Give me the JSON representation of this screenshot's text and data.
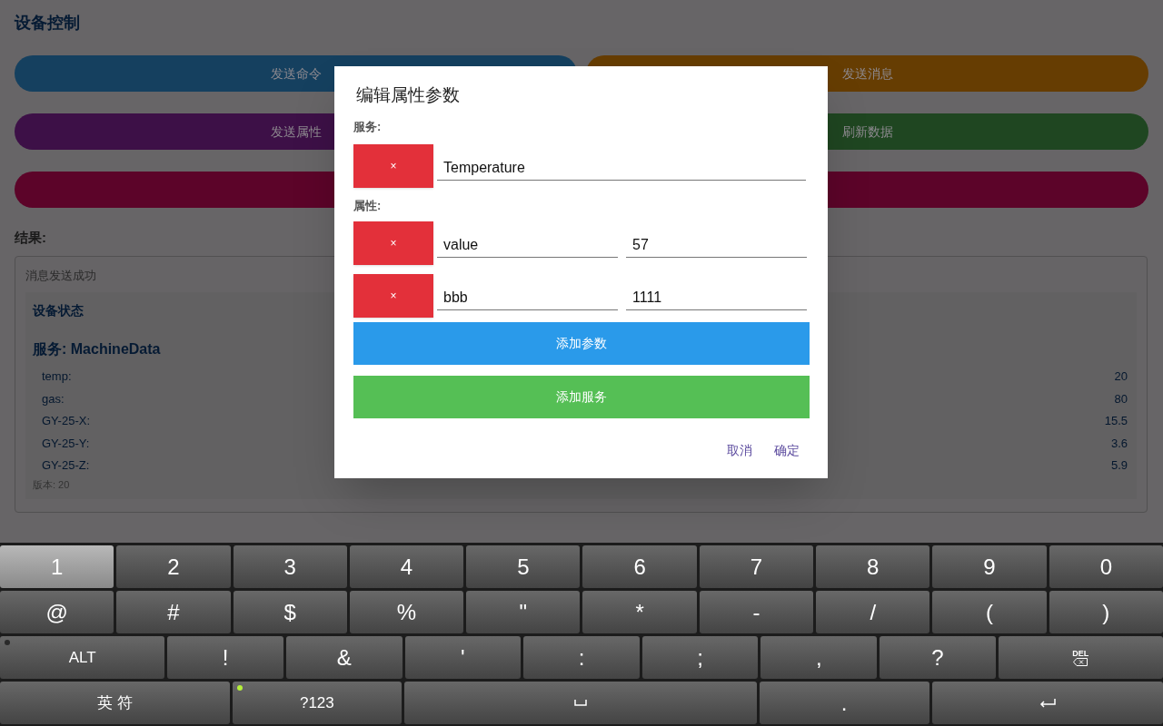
{
  "page": {
    "title": "设备控制",
    "buttons": [
      {
        "label": "发送命令",
        "color": "#15405f"
      },
      {
        "label": "发送消息",
        "color": "#663d02"
      },
      {
        "label": "发送属性",
        "color": "#3d1047"
      },
      {
        "label": "刷新数据",
        "color": "#1f4621"
      },
      {
        "color": "#5c0429",
        "wide": true
      }
    ],
    "result_label": "结果:",
    "result": {
      "message": "消息发送成功",
      "status_title": "设备状态",
      "service_title": "服务: MachineData",
      "properties": [
        {
          "name": "temp:",
          "value": "20"
        },
        {
          "name": "gas:",
          "value": "80"
        },
        {
          "name": "GY-25-X:",
          "value": "15.5"
        },
        {
          "name": "GY-25-Y:",
          "value": "3.6"
        },
        {
          "name": "GY-25-Z:",
          "value": "5.9"
        }
      ],
      "version": "版本: 20"
    }
  },
  "dialog": {
    "title": "编辑属性参数",
    "service_label": "服务:",
    "service": {
      "remove": "×",
      "value": "Temperature"
    },
    "property_label": "属性:",
    "properties": [
      {
        "remove": "×",
        "name": "value",
        "value": "57"
      },
      {
        "remove": "×",
        "name": "bbb",
        "value": "1111"
      }
    ],
    "add_param": "添加参数",
    "add_service": "添加服务",
    "cancel": "取消",
    "ok": "确定"
  },
  "keyboard": {
    "rows": [
      [
        {
          "kind": "text",
          "label": "1",
          "pressed": true
        },
        {
          "kind": "text",
          "label": "2",
          "pressed": false
        },
        {
          "kind": "text",
          "label": "3",
          "pressed": false
        },
        {
          "kind": "text",
          "label": "4",
          "pressed": false
        },
        {
          "kind": "text",
          "label": "5",
          "pressed": false
        },
        {
          "kind": "text",
          "label": "6",
          "pressed": false
        },
        {
          "kind": "text",
          "label": "7",
          "pressed": false
        },
        {
          "kind": "text",
          "label": "8",
          "pressed": false
        },
        {
          "kind": "text",
          "label": "9",
          "pressed": false
        },
        {
          "kind": "text",
          "label": "0",
          "pressed": false
        }
      ],
      [
        {
          "kind": "text",
          "label": "@",
          "pressed": false
        },
        {
          "kind": "text",
          "label": "#",
          "pressed": false
        },
        {
          "kind": "text",
          "label": "$",
          "pressed": false
        },
        {
          "kind": "text",
          "label": "%",
          "pressed": false
        },
        {
          "kind": "text",
          "label": "\"",
          "pressed": false
        },
        {
          "kind": "text",
          "label": "*",
          "pressed": false
        },
        {
          "kind": "text",
          "label": "-",
          "pressed": false
        },
        {
          "kind": "text",
          "label": "/",
          "pressed": false
        },
        {
          "kind": "text",
          "label": "(",
          "pressed": false
        },
        {
          "kind": "text",
          "label": ")",
          "pressed": false
        }
      ],
      [
        {
          "kind": "toggle",
          "label": "ALT",
          "lit": false,
          "pressed": false
        },
        {
          "kind": "text",
          "label": "!",
          "pressed": false
        },
        {
          "kind": "text",
          "label": "&",
          "pressed": false
        },
        {
          "kind": "text",
          "label": "'",
          "pressed": false
        },
        {
          "kind": "text",
          "label": ":",
          "pressed": false
        },
        {
          "kind": "text",
          "label": ";",
          "pressed": false
        },
        {
          "kind": "text",
          "label": ",",
          "pressed": false
        },
        {
          "kind": "text",
          "label": "?",
          "pressed": false
        },
        {
          "kind": "delete",
          "label": "DEL",
          "pressed": false
        }
      ],
      [
        {
          "kind": "text",
          "label": "英 符",
          "pressed": false
        },
        {
          "kind": "toggle",
          "label": "?123",
          "lit": true,
          "pressed": false
        },
        {
          "kind": "space",
          "pressed": false
        },
        {
          "kind": "text",
          "label": ".",
          "pressed": false
        },
        {
          "kind": "enter",
          "pressed": false
        }
      ]
    ]
  }
}
